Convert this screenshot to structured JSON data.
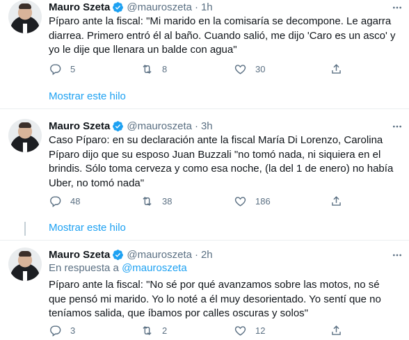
{
  "tweets": [
    {
      "name": "Mauro Szeta",
      "handle": "@mauroszeta",
      "time": "1h",
      "text": "Píparo ante la fiscal: \"Mi marido en la comisaría se decompone. Le agarra diarrea. Primero entró él al baño. Cuando salió, me dijo 'Caro es un asco' y yo le dije que llenara un balde con agua\"",
      "replies": "5",
      "retweets": "8",
      "likes": "30",
      "show_thread": "Mostrar este hilo"
    },
    {
      "name": "Mauro Szeta",
      "handle": "@mauroszeta",
      "time": "3h",
      "text": "Caso Píparo: en su declaración ante la fiscal María Di Lorenzo, Carolina Píparo dijo que su esposo Juan Buzzali \"no tomó nada, ni siquiera en el brindis. Sólo toma cerveza y como esa noche, (la del 1 de enero) no había Uber, no tomó nada\"",
      "replies": "48",
      "retweets": "38",
      "likes": "186",
      "show_thread": "Mostrar este hilo"
    },
    {
      "name": "Mauro Szeta",
      "handle": "@mauroszeta",
      "time": "2h",
      "reply_prefix": "En respuesta a",
      "reply_handle": "@mauroszeta",
      "text": "Píparo ante la fiscal: \"No sé por qué avanzamos sobre las motos, no sé que pensó mi marido. Yo lo noté a él muy desorientado. Yo sentí que no teníamos salida, que íbamos por calles oscuras y solos\"",
      "replies": "3",
      "retweets": "2",
      "likes": "12"
    }
  ],
  "separator_dot": "·",
  "icons": {
    "verified": "verified-badge-icon",
    "more": "more-dots-icon",
    "reply": "reply-icon",
    "retweet": "retweet-icon",
    "like": "heart-icon",
    "share": "share-icon"
  },
  "colors": {
    "link": "#1da1f2",
    "secondary": "#5b7083",
    "text": "#0f1419",
    "separator": "#ebeef0"
  }
}
